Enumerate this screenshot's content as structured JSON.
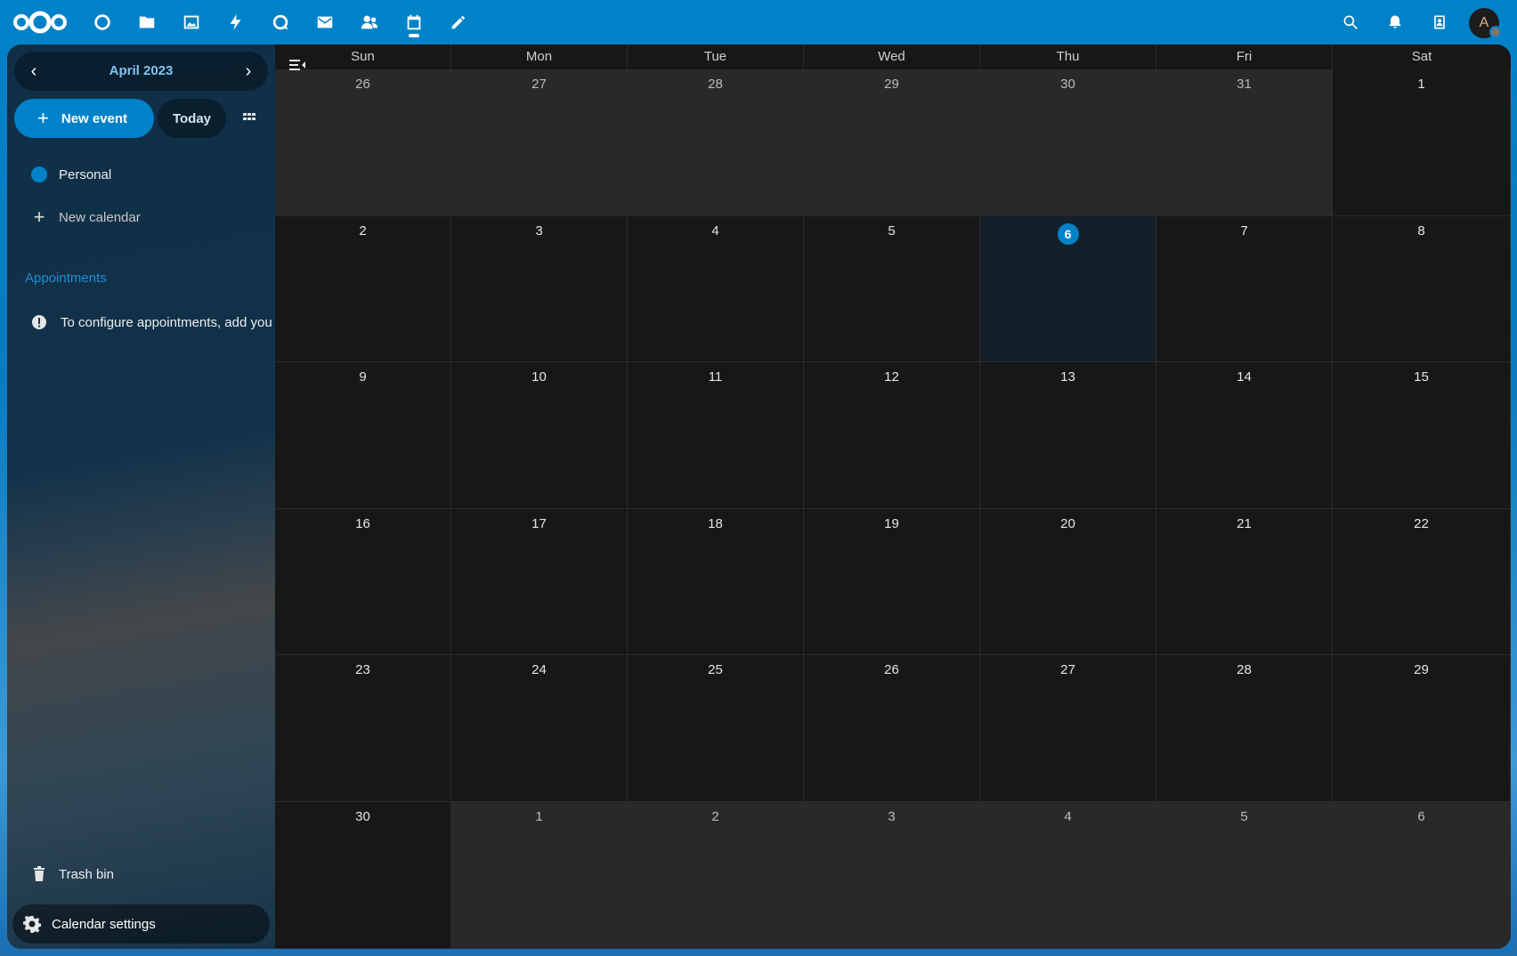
{
  "header": {
    "apps": [
      {
        "name": "dashboard",
        "icon": "dashboard-icon"
      },
      {
        "name": "files",
        "icon": "folder-icon"
      },
      {
        "name": "photos",
        "icon": "image-icon"
      },
      {
        "name": "activity",
        "icon": "lightning-icon"
      },
      {
        "name": "talk",
        "icon": "chat-icon"
      },
      {
        "name": "mail",
        "icon": "mail-icon"
      },
      {
        "name": "contacts",
        "icon": "contacts-icon"
      },
      {
        "name": "calendar",
        "icon": "calendar-icon",
        "active": true
      },
      {
        "name": "notes",
        "icon": "pencil-icon"
      }
    ],
    "avatar_initial": "A"
  },
  "sidebar": {
    "month_label": "April 2023",
    "new_event_label": "New event",
    "today_label": "Today",
    "calendars": [
      {
        "label": "Personal",
        "color": "#0082c9"
      }
    ],
    "new_calendar_label": "New calendar",
    "appointments_caption": "Appointments",
    "appointments_info": "To configure appointments, add you",
    "trash_label": "Trash bin",
    "settings_label": "Calendar settings"
  },
  "calendar": {
    "weekdays": [
      "Sun",
      "Mon",
      "Tue",
      "Wed",
      "Thu",
      "Fri",
      "Sat"
    ],
    "weeks": [
      [
        {
          "d": "26",
          "o": true
        },
        {
          "d": "27",
          "o": true
        },
        {
          "d": "28",
          "o": true
        },
        {
          "d": "29",
          "o": true
        },
        {
          "d": "30",
          "o": true
        },
        {
          "d": "31",
          "o": true
        },
        {
          "d": "1"
        }
      ],
      [
        {
          "d": "2"
        },
        {
          "d": "3"
        },
        {
          "d": "4"
        },
        {
          "d": "5"
        },
        {
          "d": "6",
          "t": true
        },
        {
          "d": "7"
        },
        {
          "d": "8"
        }
      ],
      [
        {
          "d": "9"
        },
        {
          "d": "10"
        },
        {
          "d": "11"
        },
        {
          "d": "12"
        },
        {
          "d": "13"
        },
        {
          "d": "14"
        },
        {
          "d": "15"
        }
      ],
      [
        {
          "d": "16"
        },
        {
          "d": "17"
        },
        {
          "d": "18"
        },
        {
          "d": "19"
        },
        {
          "d": "20"
        },
        {
          "d": "21"
        },
        {
          "d": "22"
        }
      ],
      [
        {
          "d": "23"
        },
        {
          "d": "24"
        },
        {
          "d": "25"
        },
        {
          "d": "26"
        },
        {
          "d": "27"
        },
        {
          "d": "28"
        },
        {
          "d": "29"
        }
      ],
      [
        {
          "d": "30"
        },
        {
          "d": "1",
          "o": true
        },
        {
          "d": "2",
          "o": true
        },
        {
          "d": "3",
          "o": true
        },
        {
          "d": "4",
          "o": true
        },
        {
          "d": "5",
          "o": true
        },
        {
          "d": "6",
          "o": true
        }
      ]
    ]
  },
  "colors": {
    "accent": "#0082c9",
    "today_bg": "#13202b"
  }
}
